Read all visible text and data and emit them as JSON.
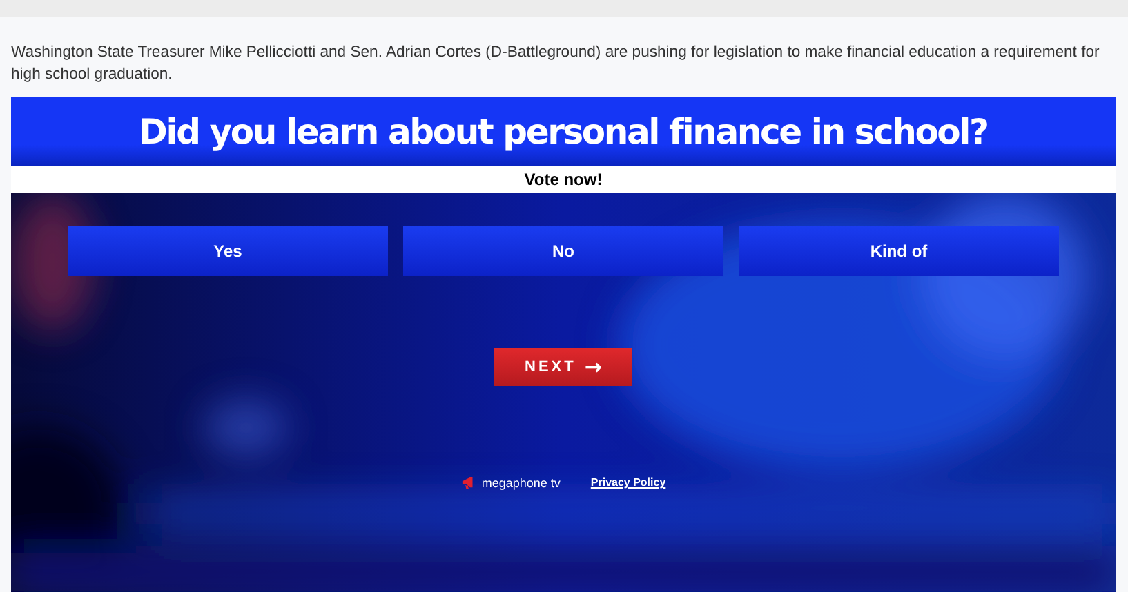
{
  "caption": "Washington State Treasurer Mike Pellicciotti and Sen. Adrian Cortes (D-Battleground) are pushing for legislation to make financial education a requirement for high school graduation.",
  "poll": {
    "question": "Did you learn about personal finance in school?",
    "prompt": "Vote now!",
    "options": [
      {
        "label": "Yes",
        "selected": false
      },
      {
        "label": "No",
        "selected": false
      },
      {
        "label": "Kind of",
        "selected": false
      }
    ],
    "next_button": "NEXT",
    "next_icon": "→",
    "brand": "megaphone tv",
    "privacy_link": "Privacy Policy"
  }
}
